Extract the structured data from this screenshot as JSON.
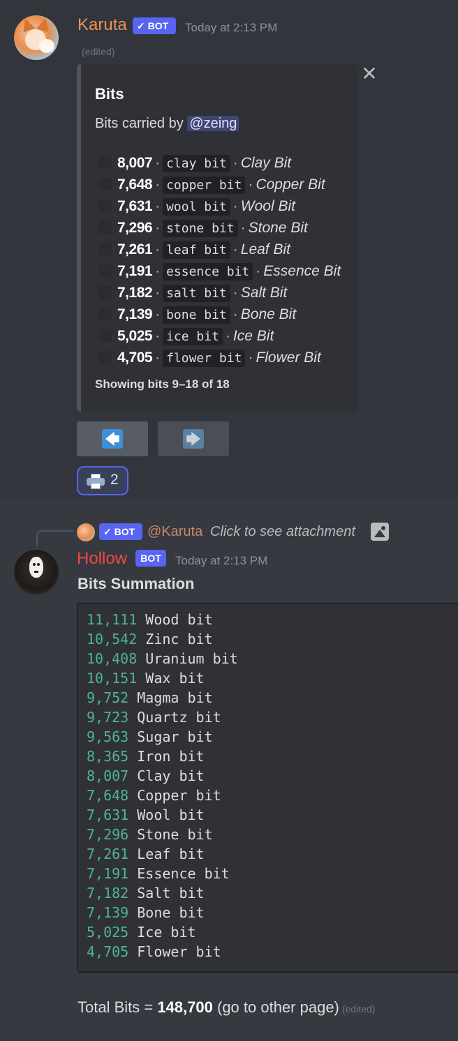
{
  "message1": {
    "author": "Karuta",
    "bot_badge": "✓ BOT",
    "timestamp": "Today at 2:13 PM",
    "edited": "(edited)",
    "embed": {
      "title": "Bits",
      "description_prefix": "Bits carried by",
      "mention": "@zeing",
      "rows": [
        {
          "count": "8,007",
          "code": "clay bit",
          "name": "Clay Bit"
        },
        {
          "count": "7,648",
          "code": "copper bit",
          "name": "Copper Bit"
        },
        {
          "count": "7,631",
          "code": "wool bit",
          "name": "Wool Bit"
        },
        {
          "count": "7,296",
          "code": "stone bit",
          "name": "Stone Bit"
        },
        {
          "count": "7,261",
          "code": "leaf bit",
          "name": "Leaf Bit"
        },
        {
          "count": "7,191",
          "code": "essence bit",
          "name": "Essence Bit"
        },
        {
          "count": "7,182",
          "code": "salt bit",
          "name": "Salt Bit"
        },
        {
          "count": "7,139",
          "code": "bone bit",
          "name": "Bone Bit"
        },
        {
          "count": "5,025",
          "code": "ice bit",
          "name": "Ice Bit"
        },
        {
          "count": "4,705",
          "code": "flower bit",
          "name": "Flower Bit"
        }
      ],
      "footer": "Showing bits 9–18 of 18",
      "separator": "·"
    },
    "close_icon": "✕",
    "prev_arrow": "🡄",
    "next_arrow": "🡆",
    "reaction": {
      "icon": "printer-icon",
      "count": "2"
    }
  },
  "message2": {
    "reply": {
      "bot_badge": "✓ BOT",
      "author": "@Karuta",
      "text": "Click to see attachment"
    },
    "author": "Hollow",
    "bot_badge": "BOT",
    "timestamp": "Today at 2:13 PM",
    "title": "Bits Summation",
    "code_rows": [
      {
        "count": "11,111",
        "name": "Wood bit"
      },
      {
        "count": "10,542",
        "name": "Zinc bit"
      },
      {
        "count": "10,408",
        "name": "Uranium bit"
      },
      {
        "count": "10,151",
        "name": "Wax bit"
      },
      {
        "count": "9,752",
        "name": "Magma bit"
      },
      {
        "count": "9,723",
        "name": "Quartz bit"
      },
      {
        "count": "9,563",
        "name": "Sugar bit"
      },
      {
        "count": "8,365",
        "name": "Iron bit"
      },
      {
        "count": "8,007",
        "name": "Clay bit"
      },
      {
        "count": "7,648",
        "name": "Copper bit"
      },
      {
        "count": "7,631",
        "name": "Wool bit"
      },
      {
        "count": "7,296",
        "name": "Stone bit"
      },
      {
        "count": "7,261",
        "name": "Leaf bit"
      },
      {
        "count": "7,191",
        "name": "Essence bit"
      },
      {
        "count": "7,182",
        "name": "Salt bit"
      },
      {
        "count": "7,139",
        "name": "Bone bit"
      },
      {
        "count": "5,025",
        "name": "Ice bit"
      },
      {
        "count": "4,705",
        "name": "Flower bit"
      }
    ],
    "total_prefix": "Total Bits = ",
    "total_value": "148,700",
    "total_suffix": " (go to other page)",
    "edited": "(edited)"
  },
  "colors": {
    "karuta_name": "#f0924f",
    "hollow_name": "#f04747",
    "bot_badge": "#5865f2",
    "code_number": "#4fb39a"
  }
}
